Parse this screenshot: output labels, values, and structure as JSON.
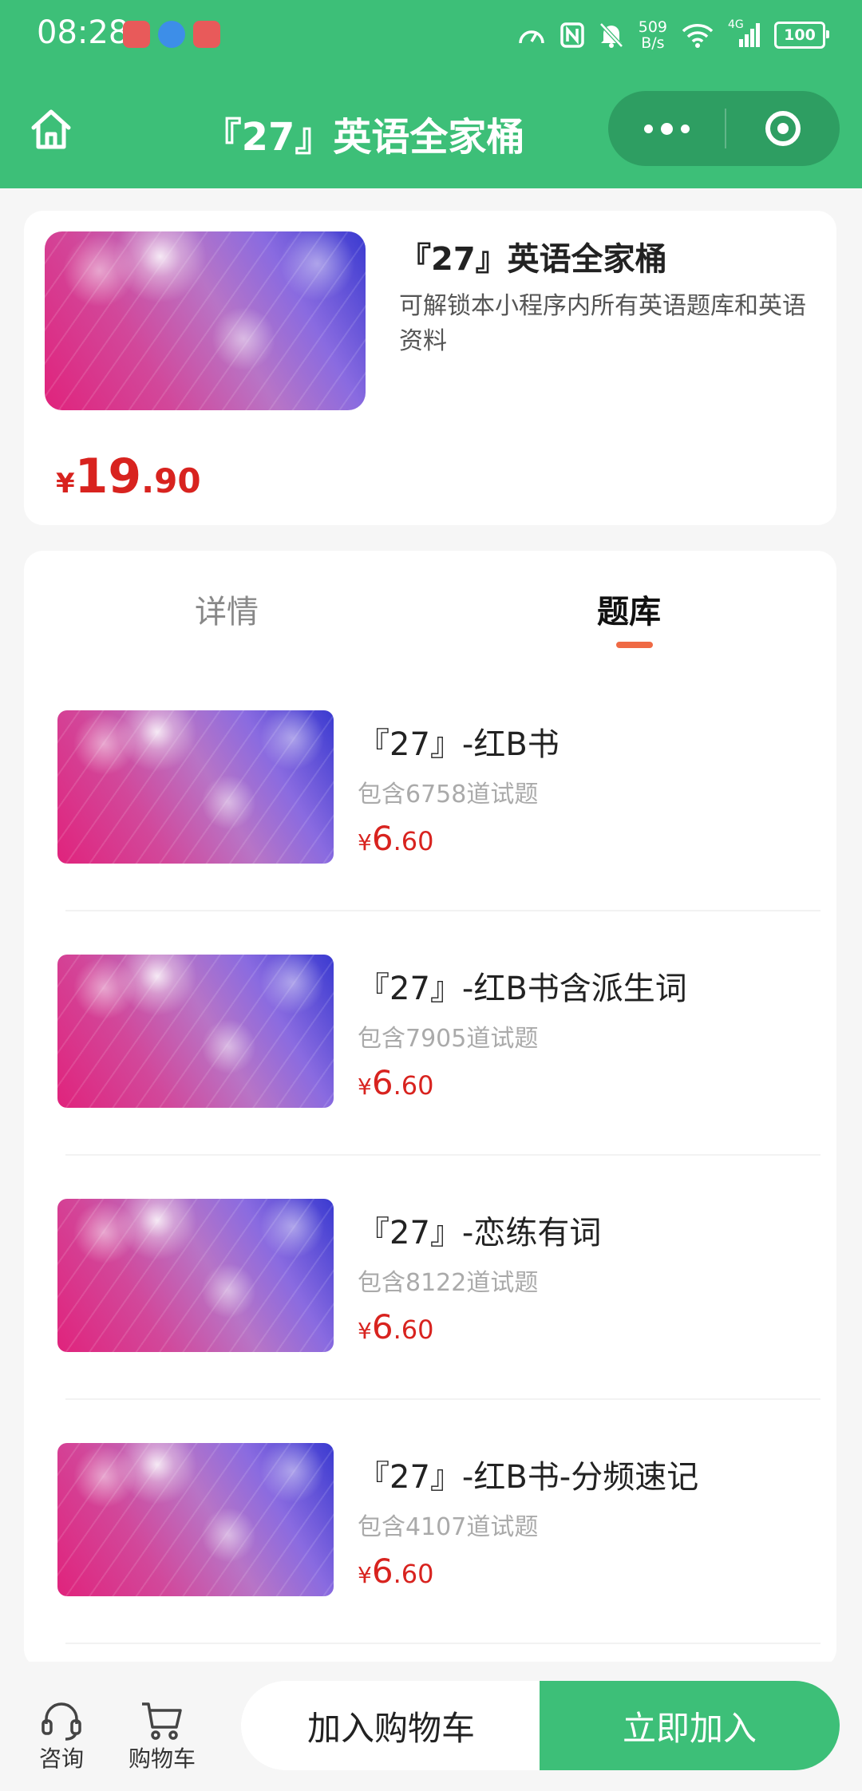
{
  "status_bar": {
    "time": "08:28",
    "net_speed_value": "509",
    "net_speed_unit": "B/s",
    "signal_label": "4G",
    "battery": "100"
  },
  "nav": {
    "title": "『27』英语全家桶"
  },
  "product": {
    "title": "『27』英语全家桶",
    "description": "可解锁本小程序内所有英语题库和英语资料",
    "price_symbol": "¥",
    "price_int": "19",
    "price_dec": ".90"
  },
  "tabs": [
    {
      "label": "详情",
      "active": false
    },
    {
      "label": "题库",
      "active": true
    }
  ],
  "question_banks": [
    {
      "name": "『27』-红B书",
      "count": "包含6758道试题",
      "price_symbol": "¥",
      "price_int": "6",
      "price_dec": ".60"
    },
    {
      "name": "『27』-红B书含派生词",
      "count": "包含7905道试题",
      "price_symbol": "¥",
      "price_int": "6",
      "price_dec": ".60"
    },
    {
      "name": "『27』-恋练有词",
      "count": "包含8122道试题",
      "price_symbol": "¥",
      "price_int": "6",
      "price_dec": ".60"
    },
    {
      "name": "『27』-红B书-分频速记",
      "count": "包含4107道试题",
      "price_symbol": "¥",
      "price_int": "6",
      "price_dec": ".60"
    }
  ],
  "bottom_bar": {
    "consult_label": "咨询",
    "cart_label": "购物车",
    "add_to_cart_label": "加入购物车",
    "join_now_label": "立即加入"
  },
  "colors": {
    "brand_green": "#3dbf78",
    "capsule_green": "#2e9e62",
    "price_red": "#d8231f",
    "tab_indicator": "#ef6a45"
  },
  "icons": [
    "home-icon",
    "more-dots-icon",
    "close-target-icon",
    "headset-icon",
    "cart-icon",
    "wifi-icon",
    "signal-icon",
    "battery-icon",
    "nfc-icon",
    "mute-bell-icon",
    "speedometer-icon"
  ]
}
